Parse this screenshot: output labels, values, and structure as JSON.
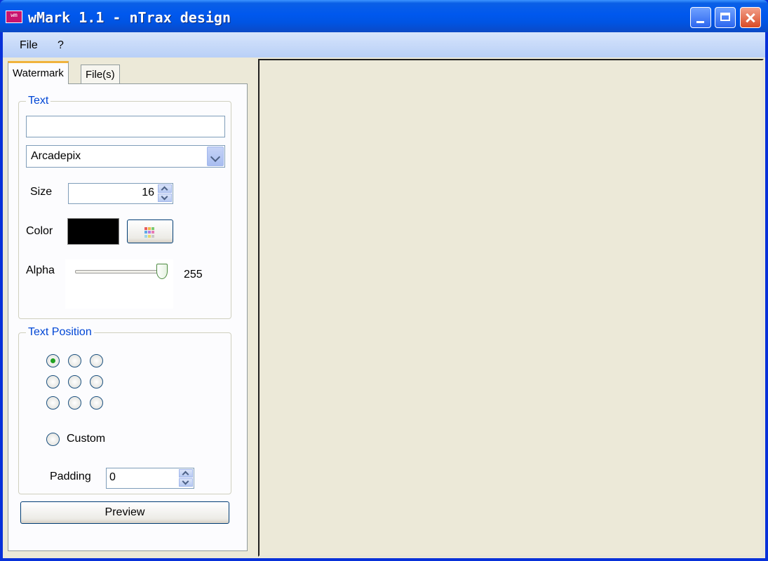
{
  "window": {
    "title": "wMark 1.1 - nTrax design",
    "icon": "wmark-app-icon"
  },
  "menu": {
    "items": [
      "File",
      "?"
    ]
  },
  "tabs": [
    {
      "label": "Watermark",
      "active": true
    },
    {
      "label": "File(s)",
      "active": false
    }
  ],
  "text_group": {
    "label": "Text",
    "text_value": "",
    "font": "Arcadepix",
    "size_label": "Size",
    "size_value": "16",
    "color_label": "Color",
    "color_value": "#000000",
    "alpha_label": "Alpha",
    "alpha_value": "255",
    "alpha_max": 255
  },
  "position_group": {
    "label": "Text Position",
    "grid": {
      "rows": 3,
      "cols": 3,
      "selected_index": 0
    },
    "custom_label": "Custom",
    "padding_label": "Padding",
    "padding_value": "0"
  },
  "buttons": {
    "preview": "Preview"
  },
  "colors": {
    "title_bar": "#0054e3",
    "accent_tab": "#f0b33c",
    "group_label": "#0046d5",
    "selected_radio": "#21a121"
  }
}
